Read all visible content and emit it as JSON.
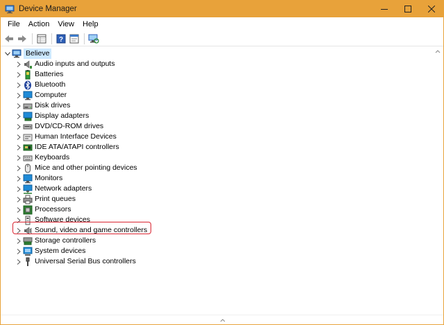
{
  "window": {
    "title": "Device Manager",
    "accent_color": "#e8a23a",
    "highlight_color": "#d9232f"
  },
  "menu": {
    "items": [
      "File",
      "Action",
      "View",
      "Help"
    ]
  },
  "toolbar": {
    "buttons": [
      "back-arrow-icon",
      "forward-arrow-icon",
      "properties-grid-icon",
      "help-icon",
      "properties-window-icon",
      "scan-monitor-icon"
    ]
  },
  "tree": {
    "root": "Believe",
    "items": [
      {
        "label": "Audio inputs and outputs",
        "icon": "speaker-icon"
      },
      {
        "label": "Batteries",
        "icon": "battery-icon"
      },
      {
        "label": "Bluetooth",
        "icon": "bluetooth-icon"
      },
      {
        "label": "Computer",
        "icon": "computer-icon"
      },
      {
        "label": "Disk drives",
        "icon": "disk-drive-icon"
      },
      {
        "label": "Display adapters",
        "icon": "display-adapter-icon"
      },
      {
        "label": "DVD/CD-ROM drives",
        "icon": "dvd-drive-icon"
      },
      {
        "label": "Human Interface Devices",
        "icon": "hid-icon"
      },
      {
        "label": "IDE ATA/ATAPI controllers",
        "icon": "ide-controller-icon"
      },
      {
        "label": "Keyboards",
        "icon": "keyboard-icon"
      },
      {
        "label": "Mice and other pointing devices",
        "icon": "mouse-icon"
      },
      {
        "label": "Monitors",
        "icon": "monitor-icon"
      },
      {
        "label": "Network adapters",
        "icon": "network-adapter-icon"
      },
      {
        "label": "Print queues",
        "icon": "printer-icon"
      },
      {
        "label": "Processors",
        "icon": "processor-icon"
      },
      {
        "label": "Software devices",
        "icon": "software-device-icon"
      },
      {
        "label": "Sound, video and game controllers",
        "icon": "sound-icon",
        "highlighted": true
      },
      {
        "label": "Storage controllers",
        "icon": "storage-controller-icon"
      },
      {
        "label": "System devices",
        "icon": "system-device-icon"
      },
      {
        "label": "Universal Serial Bus controllers",
        "icon": "usb-icon"
      }
    ]
  }
}
